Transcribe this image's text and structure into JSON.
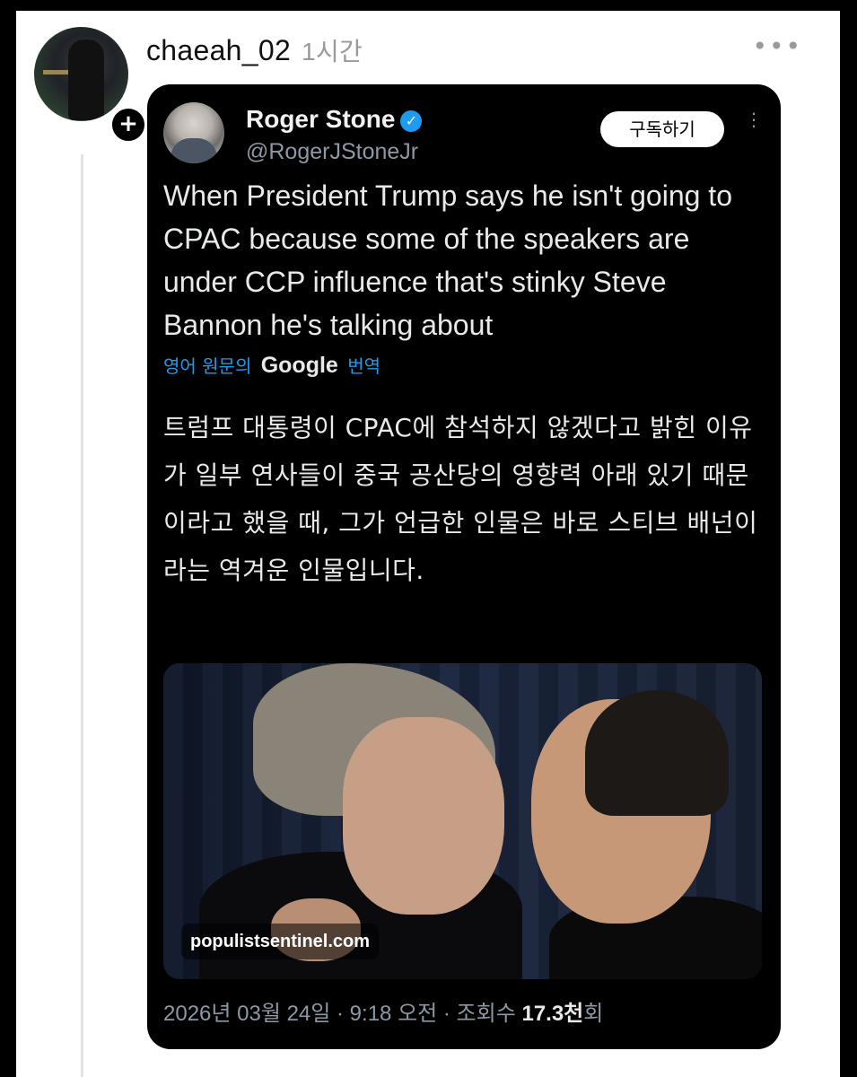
{
  "post": {
    "username": "chaeah_02",
    "time_ago": "1시간",
    "follow_icon": "+",
    "more_icon": "•••"
  },
  "tweet": {
    "author_name": "Roger Stone",
    "verified_icon": "✓",
    "handle": "@RogerJStoneJr",
    "subscribe_label": "구독하기",
    "more_icon": "⋮",
    "text": "When President Trump says he isn't going to CPAC because some of the speakers are under CCP influence that's stinky Steve Bannon he's talking about",
    "translate_prefix": "영어 원문의",
    "translate_brand": "Google",
    "translate_suffix": "번역",
    "translation": "트럼프 대통령이 CPAC에 참석하지 않겠다고 밝힌 이유가 일부 연사들이 중국 공산당의 영향력 아래 있기 때문이라고 했을 때, 그가 언급한 인물은 바로 스티브 배넌이라는 역겨운 인물입니다.",
    "media_watermark": "populistsentinel.com",
    "footer_date": "2026년 03월 24일 · 9:18 오전 · 조회수",
    "footer_views": "17.3천",
    "footer_views_suffix": "회"
  }
}
